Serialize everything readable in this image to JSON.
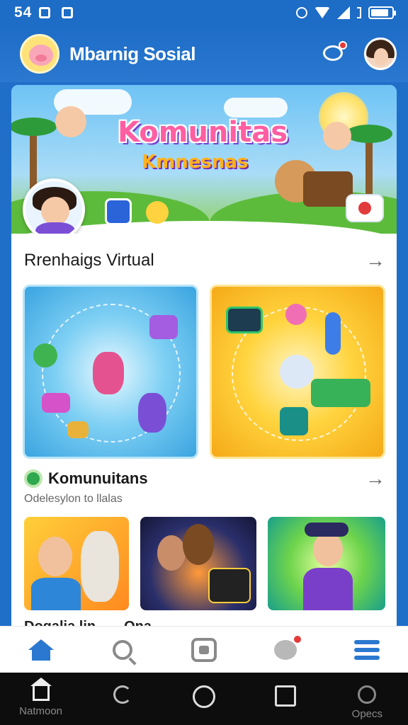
{
  "status_bar": {
    "time": "54",
    "icons": [
      "notification-icon",
      "app-icon",
      "alarm-icon",
      "wifi-icon",
      "signal-icon",
      "bluetooth-icon",
      "battery-icon"
    ]
  },
  "app_bar": {
    "title": "Mbarnig Sosial",
    "icons": [
      "logo-pig-icon",
      "chat-icon",
      "avatar-icon"
    ]
  },
  "banner": {
    "title": "Komunitas",
    "subtitle": "Kmnesnas"
  },
  "sections": {
    "virtual": {
      "title": "Rrenhaigs Virtual",
      "arrow": "→"
    },
    "community": {
      "title": "Komunuitans",
      "subtitle": "Odelesylon to llalas",
      "arrow": "→"
    },
    "peek": {
      "left": "Dogalia lin",
      "right": "Ona"
    }
  },
  "bottom_nav": {
    "items": [
      "home-icon",
      "search-icon",
      "media-icon",
      "message-icon",
      "menu-icon"
    ]
  },
  "system_nav": {
    "left_label": "Natmoon",
    "right_label": "Opecs"
  },
  "colors": {
    "primary": "#1d6cc6",
    "accent_red": "#e63a3a",
    "tile_blue": "#3aa4e0",
    "tile_yellow": "#ffd43e"
  }
}
